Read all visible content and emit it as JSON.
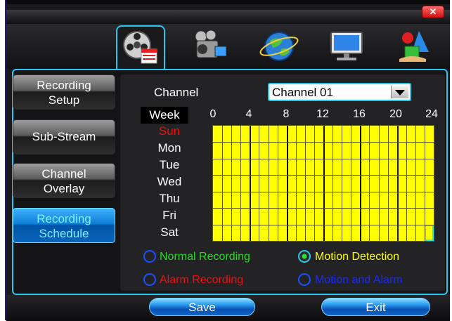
{
  "window": {
    "close_glyph": "✕"
  },
  "tabs": [
    {
      "name": "record-icon",
      "active": true
    },
    {
      "name": "camera-icon",
      "active": false
    },
    {
      "name": "network-globe-icon",
      "active": false
    },
    {
      "name": "display-monitor-icon",
      "active": false
    },
    {
      "name": "advanced-tools-icon",
      "active": false
    }
  ],
  "sidebar": {
    "items": [
      {
        "line1": "Recording",
        "line2": "Setup",
        "active": false
      },
      {
        "line1": "Sub-Stream",
        "line2": "",
        "active": false
      },
      {
        "line1": "Channel",
        "line2": "Overlay",
        "active": false
      },
      {
        "line1": "Recording",
        "line2": "Schedule",
        "active": true
      }
    ]
  },
  "schedule": {
    "channel_label": "Channel",
    "channel_value": "Channel 01",
    "week_label": "Week",
    "hours": [
      "0",
      "4",
      "8",
      "12",
      "16",
      "20",
      "24"
    ],
    "days": [
      "Sun",
      "Mon",
      "Tue",
      "Wed",
      "Thu",
      "Fri",
      "Sat"
    ],
    "grid_color": "#ffff00"
  },
  "legend": {
    "normal": {
      "label": "Normal Recording",
      "color": "#22dd22",
      "selected": false
    },
    "motion": {
      "label": "Motion Detection",
      "color": "#ffff00",
      "selected": true
    },
    "alarm": {
      "label": "Alarm Recording",
      "color": "#ee1111",
      "selected": false
    },
    "motion_alarm": {
      "label": "Motion and Alarm",
      "color": "#1a2cff",
      "selected": false
    }
  },
  "buttons": {
    "save": "Save",
    "exit": "Exit"
  }
}
